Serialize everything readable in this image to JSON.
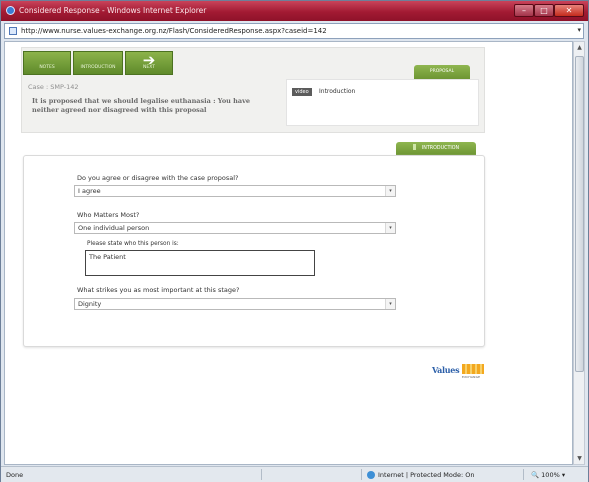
{
  "window": {
    "title": "Considered Response - Windows Internet Explorer",
    "controls": {
      "minimize": "–",
      "maximize": "□",
      "close": "✕"
    }
  },
  "address_bar": {
    "url": "http://www.nurse.values-exchange.org.nz/Flash/ConsideredResponse.aspx?caseid=142",
    "dropdown": "▾"
  },
  "nav": {
    "notes_label": "NOTES",
    "introduction_label": "INTRODUCTION",
    "next_label": "NEXT",
    "next_arrow": "➔"
  },
  "proposal": {
    "tab_label": "PROPOSAL",
    "case_label": "Case : SMP-142",
    "case_text": "It is proposed that we should legalise euthanasia : You have neither agreed nor disagreed with this proposal",
    "video_badge": "video",
    "video_title": "Introduction"
  },
  "introduction": {
    "tab_label": "INTRODUCTION",
    "q1": {
      "label": "Do you agree or disagree with the case proposal?",
      "value": "I agree"
    },
    "q2": {
      "label": "Who Matters Most?",
      "value": "One individual person"
    },
    "q2_sub": {
      "label": "Please state who this person is:",
      "value": "The Patient"
    },
    "q3": {
      "label": "What strikes you as most important at this stage?",
      "value": "Dignity"
    },
    "dropdown_glyph": "▾"
  },
  "logo": {
    "text": "Values",
    "sub": "EXCHANGE"
  },
  "status_bar": {
    "status": "Done",
    "zone": "Internet | Protected Mode: On",
    "zoom": "100%",
    "zoom_icon": "🔍"
  },
  "colors": {
    "accent_green": "#6d9533",
    "title_bar": "#a21a33"
  }
}
